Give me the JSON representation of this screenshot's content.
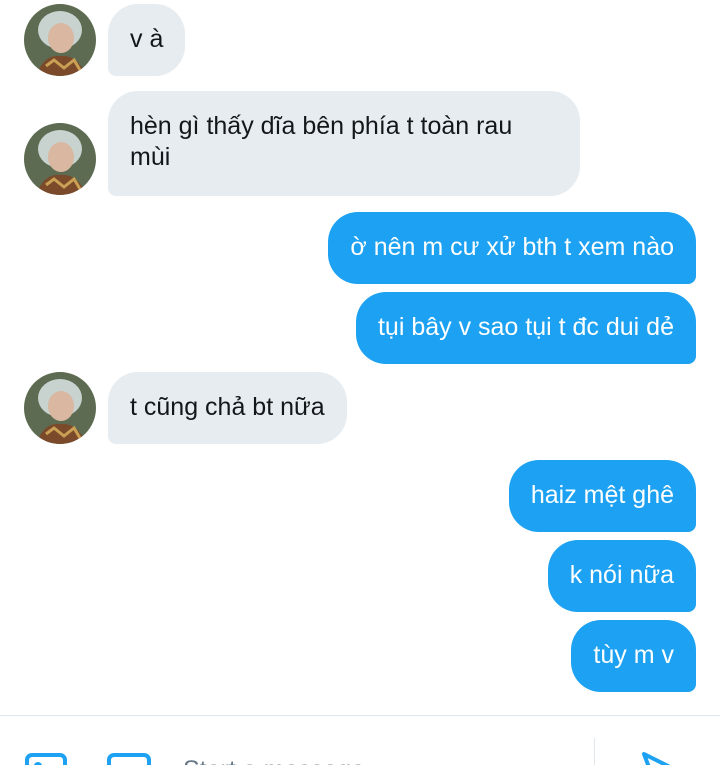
{
  "messages": [
    {
      "text": "v à"
    },
    {
      "text_line1": "hèn gì thấy dĩa bên phía t toàn rau",
      "text_line2": "mùi"
    },
    {
      "text": "ờ nên m cư xử bth t xem nào"
    },
    {
      "text": "tụi bây v sao tụi t đc dui dẻ"
    },
    {
      "text": "t cũng chả bt nữa"
    },
    {
      "text": "haiz mệt ghê"
    },
    {
      "text": "k nói nữa"
    },
    {
      "text": "tùy m v"
    }
  ],
  "composer": {
    "placeholder": "Start a message",
    "icons": [
      "image-icon",
      "gif-icon",
      "send-icon"
    ]
  },
  "colors": {
    "outgoing_bubble": "#1da1f2",
    "incoming_bubble": "#e6ecf0",
    "accent": "#1da1f2"
  }
}
